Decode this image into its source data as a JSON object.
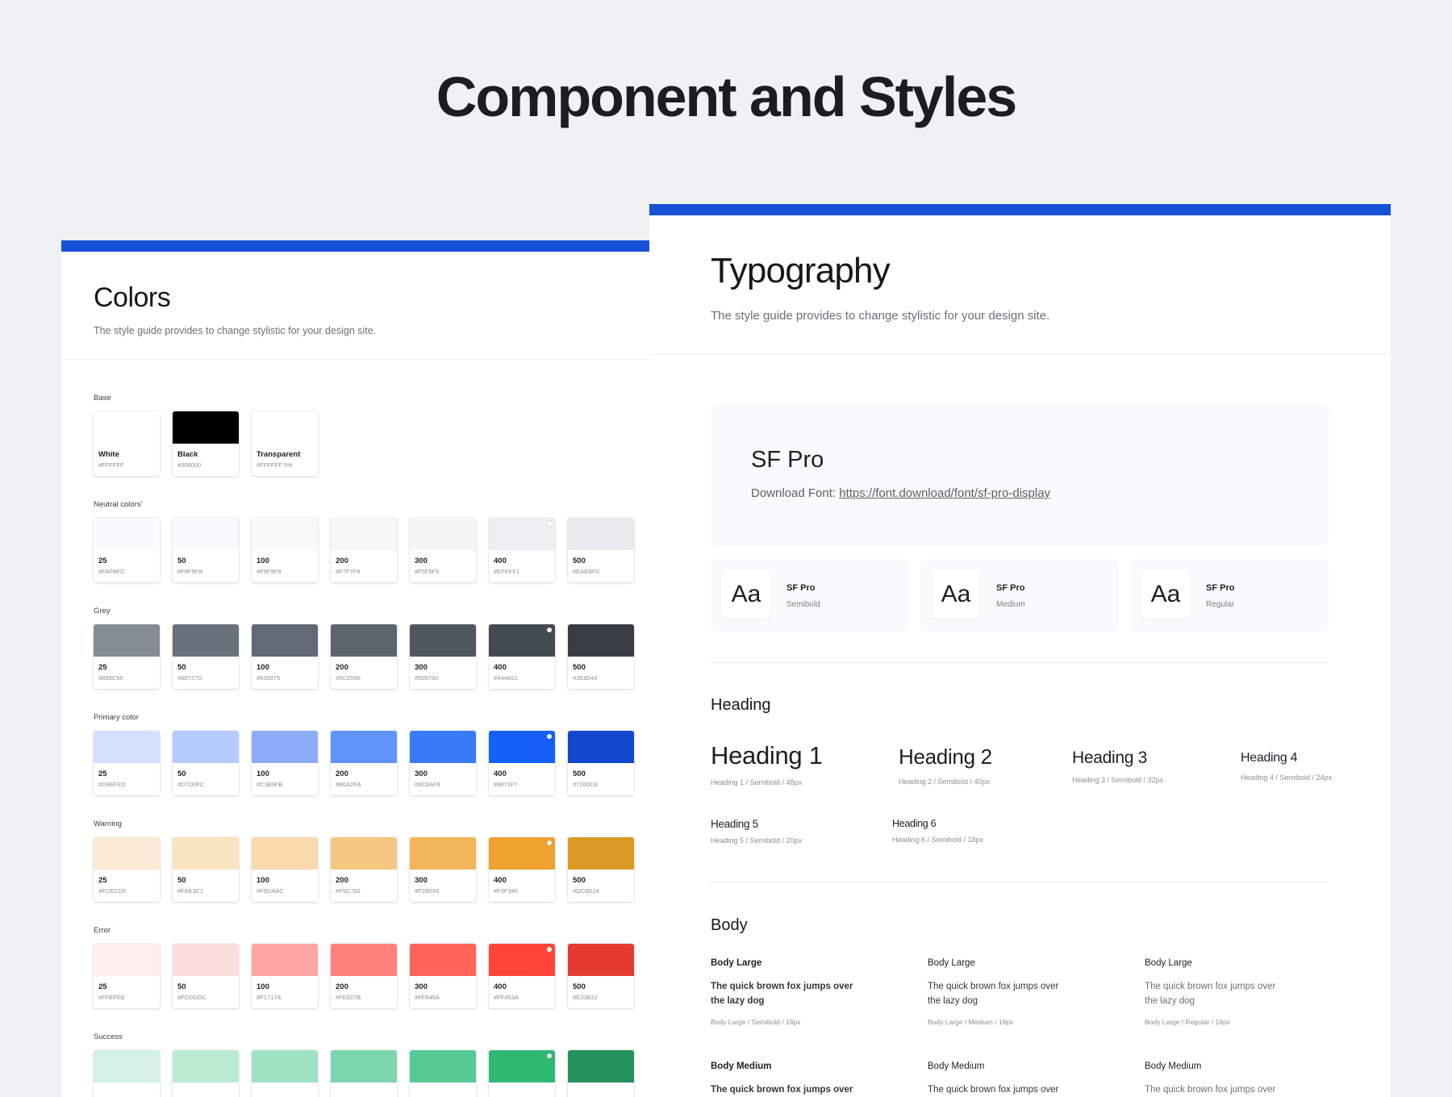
{
  "page": {
    "title": "Component and Styles"
  },
  "colors": {
    "title": "Colors",
    "subtitle": "The style guide provides to change stylistic for your design site.",
    "groups": [
      {
        "label": "Base",
        "swatches": [
          {
            "name": "White",
            "hex": "#FFFFFF",
            "color": "#FFFFFF"
          },
          {
            "name": "Black",
            "hex": "#000000",
            "color": "#000000"
          },
          {
            "name": "Transparent",
            "hex": "#FFFFFF 0%",
            "color": "#FFFFFF"
          }
        ]
      },
      {
        "label": "Neutral colors'",
        "swatches": [
          {
            "name": "25",
            "hex": "#FAFBFC",
            "color": "#FAFBFC"
          },
          {
            "name": "50",
            "hex": "#F8F9FB",
            "color": "#F8F9FB"
          },
          {
            "name": "100",
            "hex": "#F9F9F9",
            "color": "#F9F9F9"
          },
          {
            "name": "200",
            "hex": "#F7F7F8",
            "color": "#F7F7F8"
          },
          {
            "name": "300",
            "hex": "#F5F5F5",
            "color": "#F5F5F5"
          },
          {
            "name": "400",
            "hex": "#EFEFF1",
            "color": "#EFEFF1"
          },
          {
            "name": "500",
            "hex": "#EAEBF0",
            "color": "#EAEBF0"
          }
        ]
      },
      {
        "label": "Grey",
        "swatches": [
          {
            "name": "25",
            "hex": "#858C95",
            "color": "#858C95"
          },
          {
            "name": "50",
            "hex": "#68727D",
            "color": "#68727D"
          },
          {
            "name": "100",
            "hex": "#626875",
            "color": "#626875"
          },
          {
            "name": "200",
            "hex": "#5C656E",
            "color": "#5C656E"
          },
          {
            "name": "300",
            "hex": "#505760",
            "color": "#505760"
          },
          {
            "name": "400",
            "hex": "#444A51",
            "color": "#444A51"
          },
          {
            "name": "500",
            "hex": "#383D43",
            "color": "#383D43"
          }
        ]
      },
      {
        "label": "Primary color",
        "swatches": [
          {
            "name": "25",
            "hex": "#D4EFED",
            "color": "#D3E1FE"
          },
          {
            "name": "50",
            "hex": "#D7D0FC",
            "color": "#B4CBFD"
          },
          {
            "name": "100",
            "hex": "#C3B9FB",
            "color": "#8BADF9"
          },
          {
            "name": "200",
            "hex": "#B0A2FA",
            "color": "#6194FA"
          },
          {
            "name": "300",
            "hex": "#9C8AF8",
            "color": "#397BF6"
          },
          {
            "name": "400",
            "hex": "#8873F7",
            "color": "#1560FB"
          },
          {
            "name": "500",
            "hex": "#7160CE",
            "color": "#1248CF"
          }
        ]
      },
      {
        "label": "Warning",
        "swatches": [
          {
            "name": "25",
            "hex": "#FCECD5",
            "color": "#FCECD5"
          },
          {
            "name": "50",
            "hex": "#FAE3C1",
            "color": "#FAE3C1"
          },
          {
            "name": "100",
            "hex": "#F9DAAC",
            "color": "#F9DAAC"
          },
          {
            "name": "200",
            "hex": "#F5C782",
            "color": "#F5C782"
          },
          {
            "name": "300",
            "hex": "#F2B559",
            "color": "#F2B559"
          },
          {
            "name": "400",
            "hex": "#F3F346",
            "color": "#EFA22F"
          },
          {
            "name": "500",
            "hex": "#DC9D24",
            "color": "#D99A26"
          }
        ]
      },
      {
        "label": "Error",
        "swatches": [
          {
            "name": "25",
            "hex": "#FFEFEE",
            "color": "#FFEFEE"
          },
          {
            "name": "50",
            "hex": "#FDDDDC",
            "color": "#FDDDDC"
          },
          {
            "name": "100",
            "hex": "#F1717A",
            "color": "#FCA7A3"
          },
          {
            "name": "200",
            "hex": "#FE827B",
            "color": "#FE827B"
          },
          {
            "name": "300",
            "hex": "#FF645A",
            "color": "#FF645A"
          },
          {
            "name": "400",
            "hex": "#FF453A",
            "color": "#FF453A"
          },
          {
            "name": "500",
            "hex": "#E33B32",
            "color": "#E33B32"
          }
        ]
      },
      {
        "label": "Success",
        "swatches": [
          {
            "name": "",
            "hex": "",
            "color": "#D3F2E3"
          },
          {
            "name": "",
            "hex": "",
            "color": "#B9EBD3"
          },
          {
            "name": "",
            "hex": "",
            "color": "#9FE2C3"
          },
          {
            "name": "",
            "hex": "",
            "color": "#7CD6AC"
          },
          {
            "name": "",
            "hex": "",
            "color": "#57C994"
          },
          {
            "name": "",
            "hex": "",
            "color": "#2FB872"
          },
          {
            "name": "",
            "hex": "",
            "color": "#25915B"
          }
        ]
      }
    ]
  },
  "typography": {
    "title": "Typography",
    "subtitle": "The style guide provides to change stylistic for your design site.",
    "font": {
      "name": "SF Pro",
      "download_label": "Download Font:",
      "download_url": "https://font.download/font/sf-pro-display"
    },
    "weights": [
      {
        "aa": "Aa",
        "name": "SF Pro",
        "weight": "Semibold"
      },
      {
        "aa": "Aa",
        "name": "SF Pro",
        "weight": "Medium"
      },
      {
        "aa": "Aa",
        "name": "SF Pro",
        "weight": "Regular"
      }
    ],
    "heading_section": "Heading",
    "headings": [
      {
        "text": "Heading 1",
        "meta": "Heading 1 / Semibold / 48px"
      },
      {
        "text": "Heading 2",
        "meta": "Heading 2 / Semibold / 40px"
      },
      {
        "text": "Heading 3",
        "meta": "Heading 3 / Semibold / 32px"
      },
      {
        "text": "Heading 4",
        "meta": "Heading 4 / Semibold / 24px"
      },
      {
        "text": "Heading 5",
        "meta": "Heading 5 / Semibold / 20px"
      },
      {
        "text": "Heading 6",
        "meta": "Heading 6 / Semibold / 18px"
      }
    ],
    "body_section": "Body",
    "body": [
      {
        "label": "Body Large",
        "text": "The quick brown fox jumps over the lazy dog",
        "meta": "Body Large / Semibold / 18px"
      },
      {
        "label": "Body Large",
        "text": "The quick brown fox jumps over the lazy dog",
        "meta": "Body Large / Medium / 18px"
      },
      {
        "label": "Body Large",
        "text": "The quick brown fox jumps over the lazy dog",
        "meta": "Body Large / Regular / 18px"
      },
      {
        "label": "Body Medium",
        "text": "The quick brown fox jumps over",
        "meta": ""
      },
      {
        "label": "Body Medium",
        "text": "The quick brown fox jumps over",
        "meta": ""
      },
      {
        "label": "Body Medium",
        "text": "The quick brown fox jumps over",
        "meta": ""
      }
    ]
  }
}
